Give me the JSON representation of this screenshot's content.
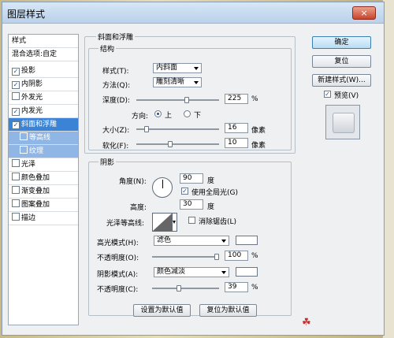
{
  "window": {
    "title": "图层样式",
    "close_label": "×"
  },
  "styles_list": [
    {
      "label": "样式",
      "checkbox": false,
      "checked": false
    },
    {
      "label": "混合选项:自定",
      "checkbox": false,
      "checked": false
    },
    {
      "label": "投影",
      "checkbox": true,
      "checked": true
    },
    {
      "label": "内阴影",
      "checkbox": true,
      "checked": true
    },
    {
      "label": "外发光",
      "checkbox": true,
      "checked": false
    },
    {
      "label": "内发光",
      "checkbox": true,
      "checked": true
    },
    {
      "label": "斜面和浮雕",
      "checkbox": true,
      "checked": true,
      "selected": true
    },
    {
      "label": "等高线",
      "checkbox": true,
      "checked": false,
      "sub": true
    },
    {
      "label": "纹理",
      "checkbox": true,
      "checked": false,
      "sub": true
    },
    {
      "label": "光泽",
      "checkbox": true,
      "checked": false
    },
    {
      "label": "颜色叠加",
      "checkbox": true,
      "checked": false
    },
    {
      "label": "渐变叠加",
      "checkbox": true,
      "checked": false
    },
    {
      "label": "图案叠加",
      "checkbox": true,
      "checked": false
    },
    {
      "label": "描边",
      "checkbox": true,
      "checked": false
    }
  ],
  "bevel": {
    "section_title": "斜面和浮雕",
    "structure_title": "结构",
    "style_label": "样式(T):",
    "style_value": "内斜面",
    "technique_label": "方法(Q):",
    "technique_value": "雕刻清晰",
    "depth_label": "深度(D):",
    "depth_value": "225",
    "depth_unit": "%",
    "depth_level": 0.62,
    "direction_label": "方向:",
    "dir_up": "上",
    "dir_down": "下",
    "direction_selected": "上",
    "size_label": "大小(Z):",
    "size_value": "16",
    "size_unit": "像素",
    "size_level": 0.1,
    "soften_label": "软化(F):",
    "soften_value": "10",
    "soften_unit": "像素",
    "soften_level": 0.4
  },
  "shading": {
    "title": "阴影",
    "angle_label": "角度(N):",
    "angle_value": "90",
    "angle_unit": "度",
    "global_light_label": "使用全局光(G)",
    "global_light_checked": true,
    "altitude_label": "高度:",
    "altitude_value": "30",
    "altitude_unit": "度",
    "gloss_label": "光泽等高线:",
    "antialias_label": "消除锯齿(L)",
    "antialias_checked": false,
    "highlight_mode_label": "高光模式(H):",
    "highlight_mode_value": "滤色",
    "highlight_color": "#ffffff",
    "highlight_opacity_label": "不透明度(O):",
    "highlight_opacity_value": "100",
    "highlight_opacity_unit": "%",
    "highlight_opacity_level": 1.0,
    "shadow_mode_label": "阴影模式(A):",
    "shadow_mode_value": "颜色减淡",
    "shadow_color": "#ffffff",
    "shadow_opacity_label": "不透明度(C):",
    "shadow_opacity_value": "39",
    "shadow_opacity_unit": "%",
    "shadow_opacity_level": 0.39
  },
  "bottom_buttons": {
    "set_default": "设置为默认值",
    "reset_default": "复位为默认值"
  },
  "right_buttons": {
    "ok": "确定",
    "reset": "复位",
    "new_style": "新建样式(W)...",
    "preview_label": "预览(V)",
    "preview_checked": true
  }
}
